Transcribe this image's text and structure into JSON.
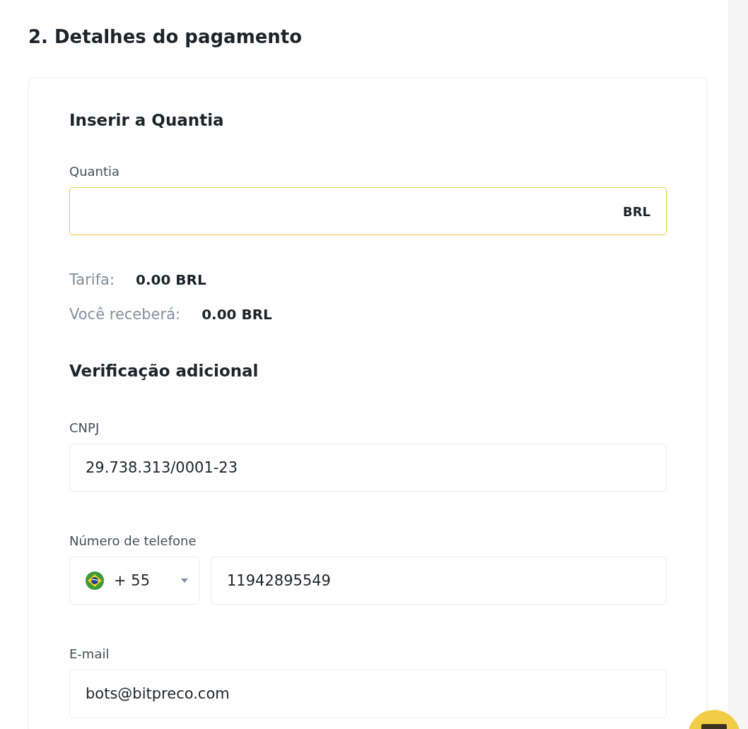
{
  "section": {
    "title": "2. Detalhes do pagamento"
  },
  "amount": {
    "heading": "Inserir a Quantia",
    "label": "Quantia",
    "currency": "BRL",
    "focused": true
  },
  "summary": [
    {
      "label": "Tarifa:",
      "value": "0.00 BRL"
    },
    {
      "label": "Você receberá:",
      "value": "0.00 BRL"
    }
  ],
  "verification": {
    "heading": "Verificação adicional",
    "fields": [
      {
        "kind": "text",
        "label": "CNPJ",
        "value": "29.738.313/0001-23"
      },
      {
        "kind": "phone",
        "label": "Número de telefone",
        "country_code": "+ 55",
        "value": "11942895549"
      },
      {
        "kind": "text",
        "label": "E-mail",
        "value": "bots@bitpreco.com"
      }
    ]
  }
}
